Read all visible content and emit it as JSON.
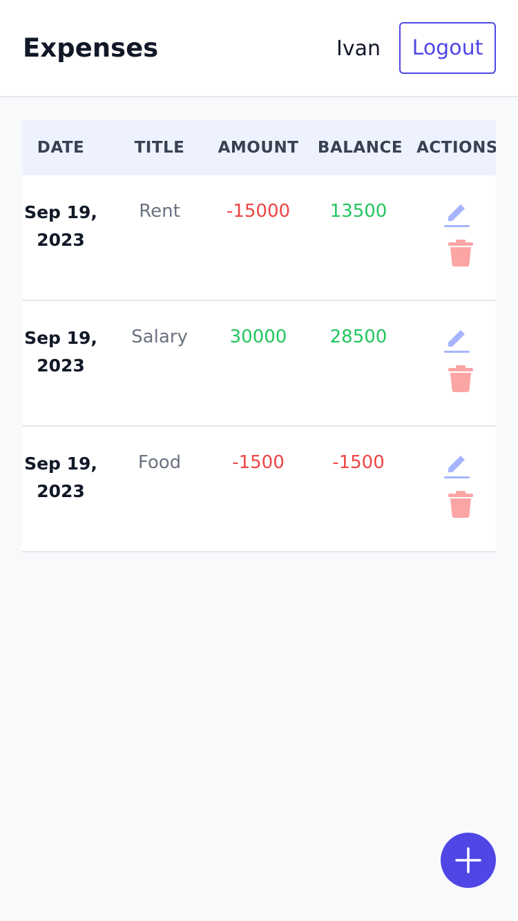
{
  "header": {
    "title": "Expenses",
    "user": "Ivan",
    "logout_label": "Logout"
  },
  "table": {
    "columns": [
      "DATE",
      "TITLE",
      "AMOUNT",
      "BALANCE",
      "ACTIONS"
    ],
    "rows": [
      {
        "date": "Sep 19, 2023",
        "title": "Rent",
        "amount": "-15000",
        "balance": "13500",
        "amount_sign": "neg",
        "balance_sign": "pos"
      },
      {
        "date": "Sep 19, 2023",
        "title": "Salary",
        "amount": "30000",
        "balance": "28500",
        "amount_sign": "pos",
        "balance_sign": "pos"
      },
      {
        "date": "Sep 19, 2023",
        "title": "Food",
        "amount": "-1500",
        "balance": "-1500",
        "amount_sign": "neg",
        "balance_sign": "neg"
      }
    ]
  },
  "icons": {
    "edit": "pencil-icon",
    "delete": "trash-icon",
    "add": "plus-icon"
  },
  "colors": {
    "accent": "#4f46e5",
    "negative": "#ef4444",
    "positive": "#22c55e",
    "edit_icon": "#a5b4fc",
    "delete_icon": "#fca5a5"
  }
}
